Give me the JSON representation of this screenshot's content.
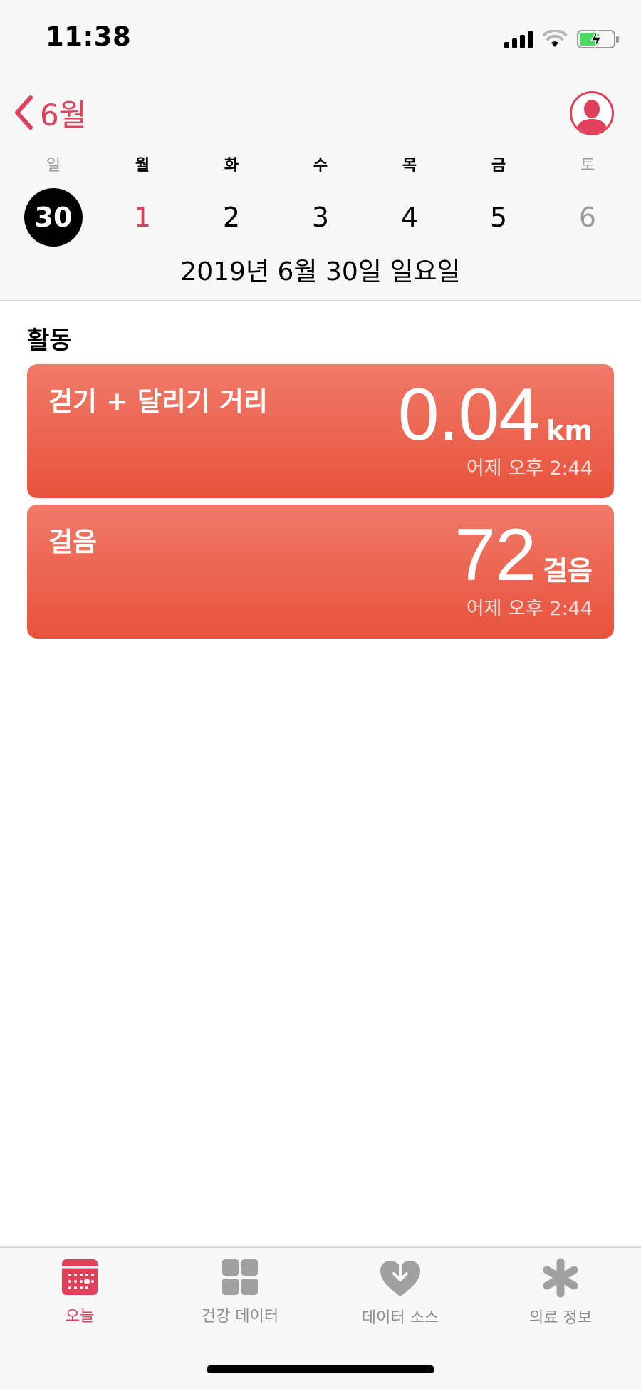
{
  "status_bar": {
    "time": "11:38"
  },
  "nav": {
    "back_label": "6월"
  },
  "week": {
    "weekdays": [
      "일",
      "월",
      "화",
      "수",
      "목",
      "금",
      "토"
    ],
    "dates": [
      "30",
      "1",
      "2",
      "3",
      "4",
      "5",
      "6"
    ],
    "selected_index": 0
  },
  "full_date": "2019년 6월 30일 일요일",
  "section": {
    "title": "활동"
  },
  "cards": [
    {
      "title": "걷기 + 달리기 거리",
      "value": "0.04",
      "unit": "km",
      "time": "어제 오후 2:44"
    },
    {
      "title": "걸음",
      "value": "72",
      "unit": "걸음",
      "time": "어제 오후 2:44"
    }
  ],
  "tabs": [
    {
      "label": "오늘",
      "icon": "calendar-icon",
      "active": true
    },
    {
      "label": "건강 데이터",
      "icon": "grid-icon",
      "active": false
    },
    {
      "label": "데이터 소스",
      "icon": "heart-download-icon",
      "active": false
    },
    {
      "label": "의료 정보",
      "icon": "asterisk-icon",
      "active": false
    }
  ],
  "colors": {
    "accent": "#e0405a",
    "card_top": "#f07a68",
    "card_bottom": "#e8523c"
  }
}
